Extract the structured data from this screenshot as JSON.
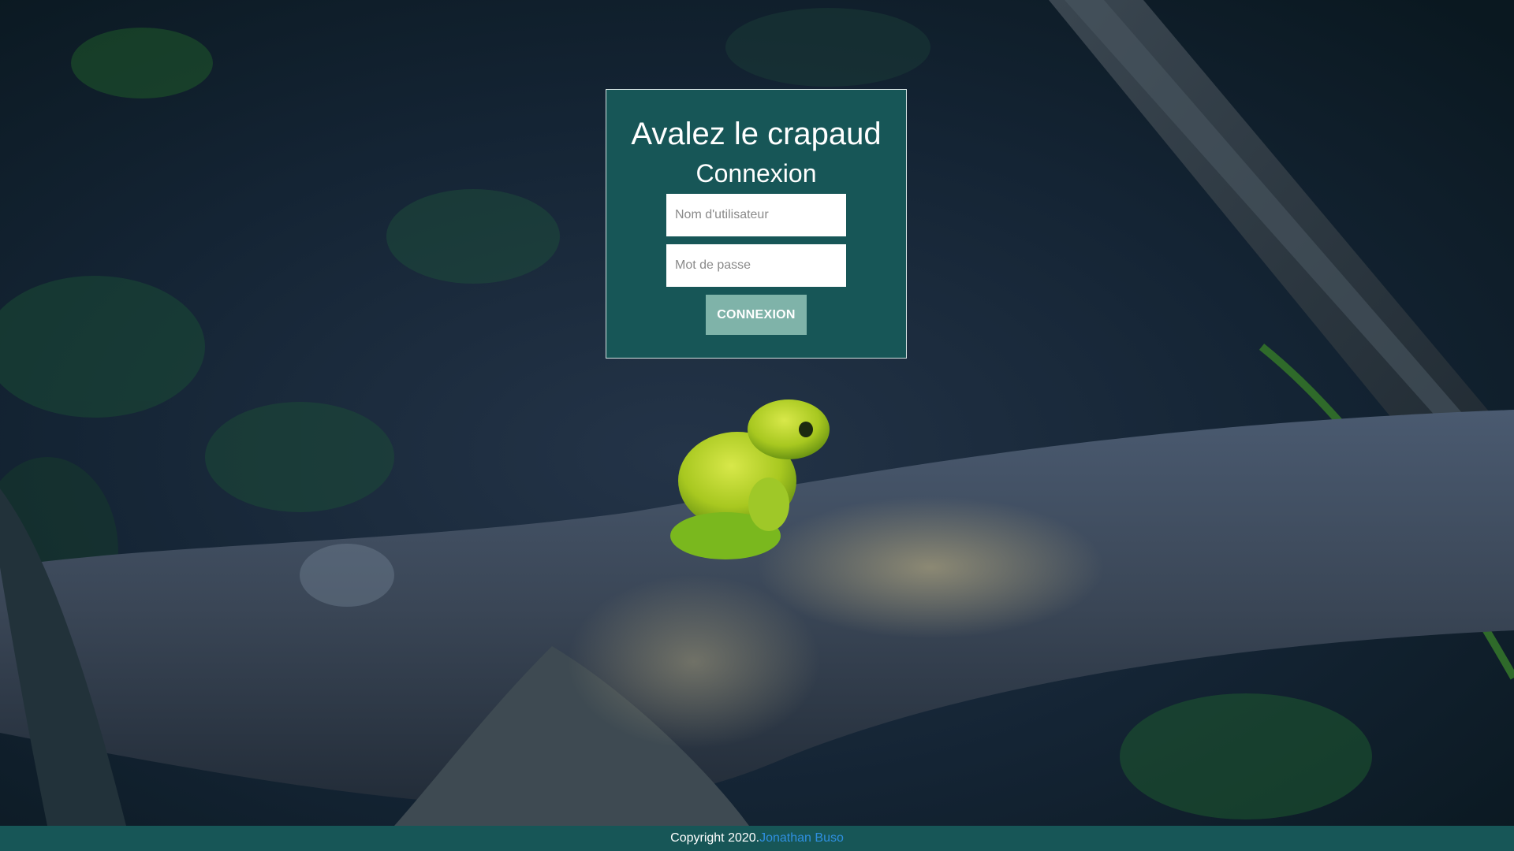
{
  "login": {
    "title": "Avalez le crapaud",
    "subtitle": "Connexion",
    "username_placeholder": "Nom d'utilisateur",
    "username_value": "",
    "password_placeholder": "Mot de passe",
    "password_value": "",
    "submit_label": "CONNEXION"
  },
  "footer": {
    "copyright": "Copyright 2020.",
    "author_link": "Jonathan Buso"
  },
  "background": {
    "icon": "frog-on-branch-photo"
  },
  "colors": {
    "panel": "#175657",
    "button": "#7fb3a9",
    "footer": "#175657",
    "link": "#2f8fe0"
  }
}
